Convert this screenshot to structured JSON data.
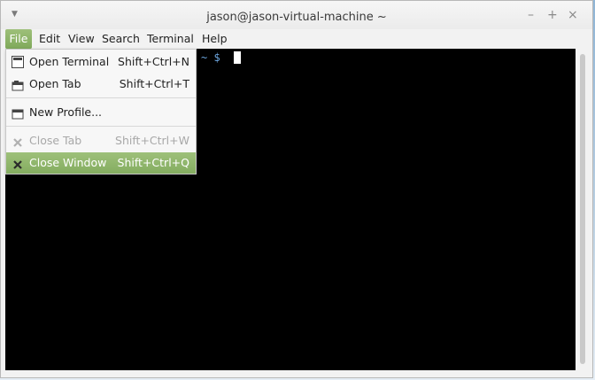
{
  "window": {
    "title": "jason@jason-virtual-machine ~",
    "menu_glyph": "▼",
    "minimize_glyph": "–",
    "maximize_glyph": "+",
    "close_glyph": "×"
  },
  "menubar": {
    "items": [
      {
        "label": "File"
      },
      {
        "label": "Edit"
      },
      {
        "label": "View"
      },
      {
        "label": "Search"
      },
      {
        "label": "Terminal"
      },
      {
        "label": "Help"
      }
    ],
    "active_color": "#8db46a"
  },
  "terminal": {
    "prompt": "~ $",
    "background": "#000000",
    "prompt_color": "#6da7e0"
  },
  "file_menu": {
    "items": [
      {
        "label": "Open Terminal",
        "accel": "Shift+Ctrl+N",
        "icon": "terminal-icon",
        "enabled": true
      },
      {
        "label": "Open Tab",
        "accel": "Shift+Ctrl+T",
        "icon": "new-tab-icon",
        "enabled": true
      },
      {
        "label": "New Profile...",
        "accel": "",
        "icon": "profile-icon",
        "enabled": true
      },
      {
        "label": "Close Tab",
        "accel": "Shift+Ctrl+W",
        "icon": "close-icon",
        "enabled": false
      },
      {
        "label": "Close Window",
        "accel": "Shift+Ctrl+Q",
        "icon": "close-icon",
        "enabled": true,
        "highlighted": true
      }
    ]
  }
}
